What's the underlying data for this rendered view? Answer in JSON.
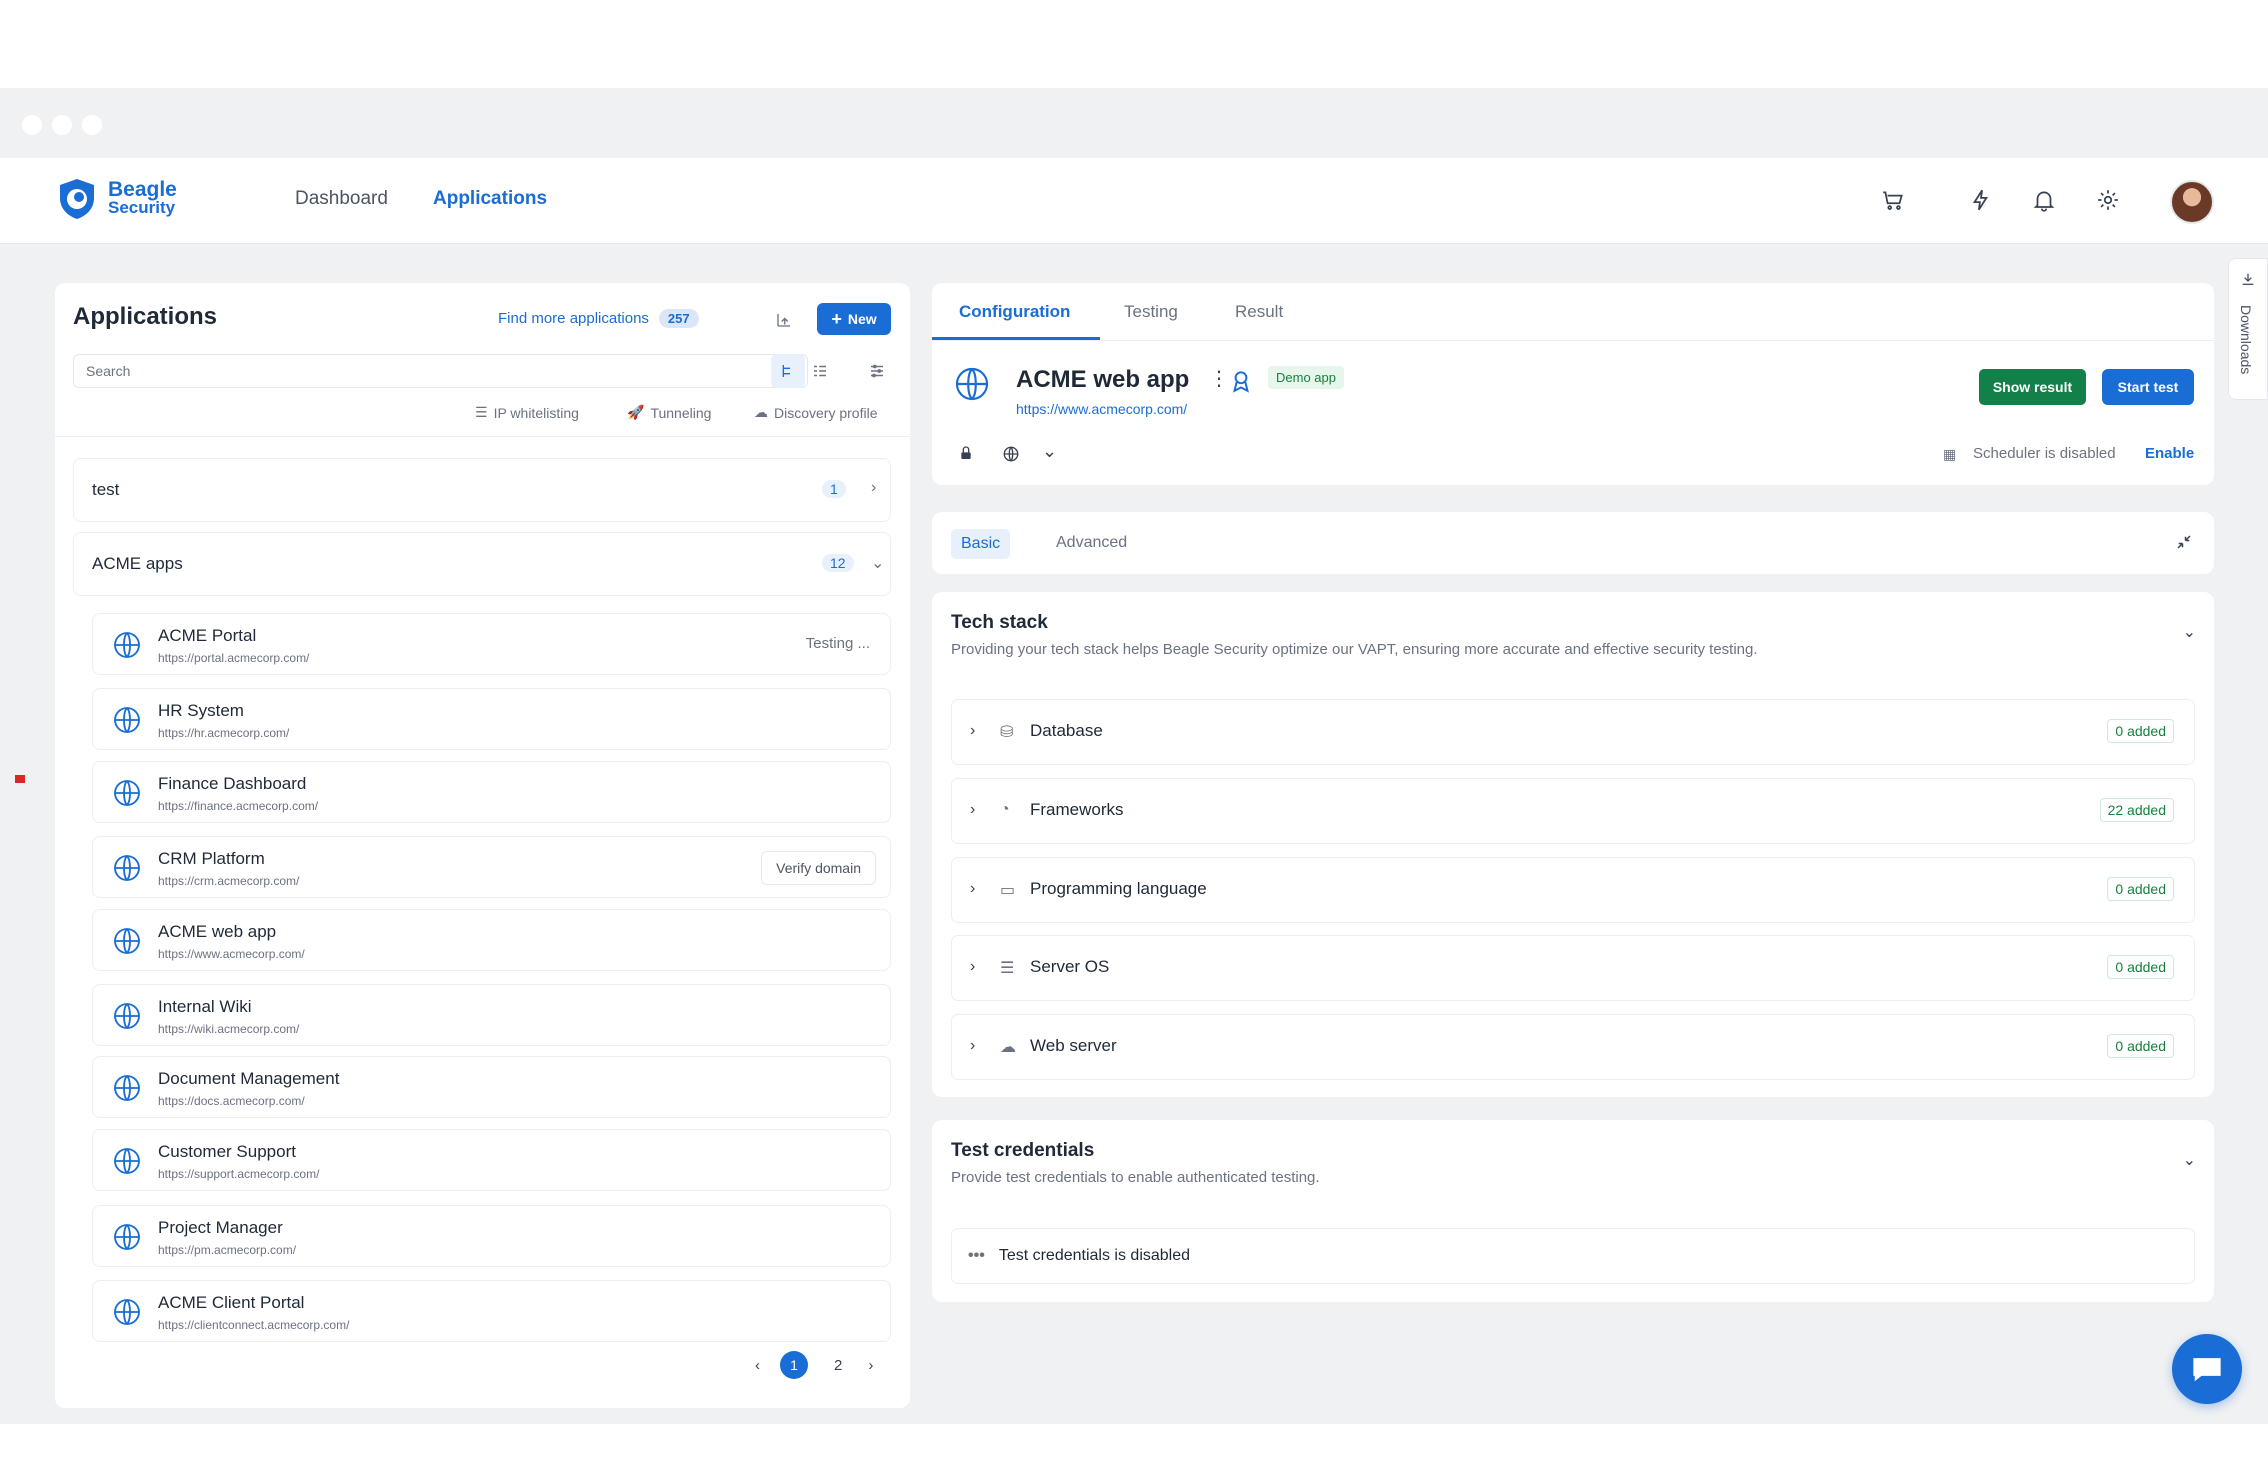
{
  "brand": {
    "line1": "Beagle",
    "line2": "Security"
  },
  "nav": {
    "dashboard": "Dashboard",
    "applications": "Applications"
  },
  "top_icons": [
    "cart-icon",
    "bolt-icon",
    "bell-icon",
    "gear-icon"
  ],
  "left": {
    "title": "Applications",
    "find_more": "Find more applications",
    "find_more_count": "257",
    "new_label": "New",
    "search_placeholder": "Search",
    "filters": {
      "ip": "IP whitelisting",
      "tunneling": "Tunneling",
      "discovery": "Discovery profile"
    },
    "groups": [
      {
        "name": "test",
        "count": "1"
      },
      {
        "name": "ACME apps",
        "count": "12"
      }
    ],
    "apps": [
      {
        "name": "ACME Portal",
        "url": "https://portal.acmecorp.com/",
        "status": "Testing ..."
      },
      {
        "name": "HR System",
        "url": "https://hr.acmecorp.com/"
      },
      {
        "name": "Finance Dashboard",
        "url": "https://finance.acmecorp.com/"
      },
      {
        "name": "CRM Platform",
        "url": "https://crm.acmecorp.com/",
        "action": "Verify domain"
      },
      {
        "name": "ACME web app",
        "url": "https://www.acmecorp.com/"
      },
      {
        "name": "Internal Wiki",
        "url": "https://wiki.acmecorp.com/"
      },
      {
        "name": "Document Management",
        "url": "https://docs.acmecorp.com/"
      },
      {
        "name": "Customer Support",
        "url": "https://support.acmecorp.com/"
      },
      {
        "name": "Project Manager",
        "url": "https://pm.acmecorp.com/"
      },
      {
        "name": "ACME Client Portal",
        "url": "https://clientconnect.acmecorp.com/"
      }
    ],
    "pagination": {
      "current": "1",
      "next": "2"
    }
  },
  "detail": {
    "tabs": [
      "Configuration",
      "Testing",
      "Result"
    ],
    "app_name": "ACME web app",
    "app_url": "https://www.acmecorp.com/",
    "demo_badge": "Demo app",
    "show_result": "Show result",
    "start_test": "Start test",
    "scheduler": "Scheduler is disabled",
    "enable": "Enable",
    "subtabs": {
      "basic": "Basic",
      "advanced": "Advanced"
    }
  },
  "tech": {
    "title": "Tech stack",
    "desc": "Providing your tech stack helps Beagle Security optimize our VAPT, ensuring more accurate and effective security testing.",
    "items": [
      {
        "name": "Database",
        "added": "0 added"
      },
      {
        "name": "Frameworks",
        "added": "22 added"
      },
      {
        "name": "Programming language",
        "added": "0 added"
      },
      {
        "name": "Server OS",
        "added": "0 added"
      },
      {
        "name": "Web server",
        "added": "0 added"
      }
    ]
  },
  "creds": {
    "title": "Test credentials",
    "desc": "Provide test credentials to enable authenticated testing.",
    "status": "Test credentials is disabled"
  },
  "side": {
    "downloads": "Downloads"
  },
  "colors": {
    "accent": "#1a6dd4",
    "success": "#13804a",
    "background": "#f0f1f3"
  }
}
